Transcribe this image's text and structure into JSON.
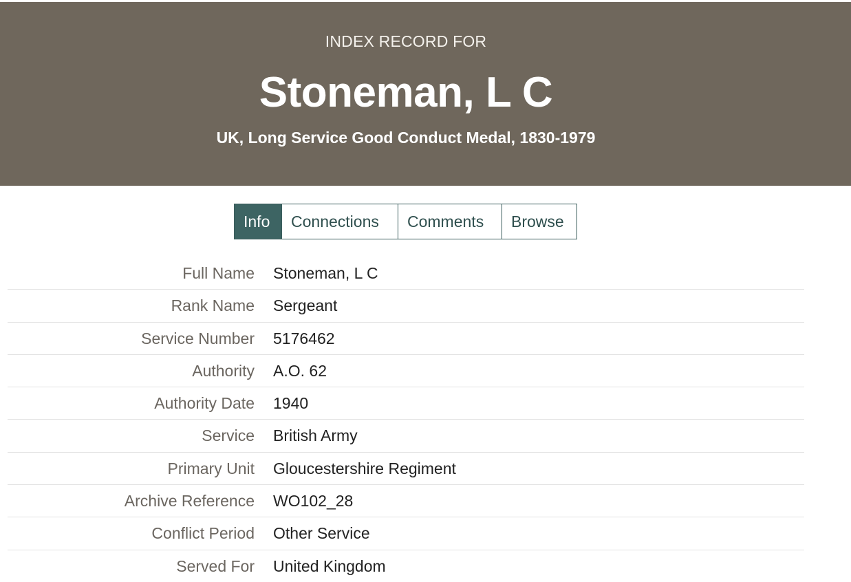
{
  "header": {
    "kicker": "INDEX RECORD FOR",
    "title": "Stoneman, L C",
    "subtitle": "UK, Long Service Good Conduct Medal, 1830-1979"
  },
  "tabs": [
    {
      "label": "Info",
      "active": true
    },
    {
      "label": "Connections",
      "active": false
    },
    {
      "label": "Comments",
      "active": false
    },
    {
      "label": "Browse",
      "active": false
    }
  ],
  "details": [
    {
      "label": "Full Name",
      "value": "Stoneman, L C"
    },
    {
      "label": "Rank Name",
      "value": "Sergeant"
    },
    {
      "label": "Service Number",
      "value": "5176462"
    },
    {
      "label": "Authority",
      "value": "A.O. 62"
    },
    {
      "label": "Authority Date",
      "value": "1940"
    },
    {
      "label": "Service",
      "value": "British Army"
    },
    {
      "label": "Primary Unit",
      "value": "Gloucestershire Regiment"
    },
    {
      "label": "Archive Reference",
      "value": "WO102_28"
    },
    {
      "label": "Conflict Period",
      "value": "Other Service"
    },
    {
      "label": "Served For",
      "value": "United Kingdom"
    }
  ],
  "colors": {
    "header_bg": "#6f675c",
    "tab_active_bg": "#3d6463",
    "tab_border": "#3a5d5c"
  }
}
